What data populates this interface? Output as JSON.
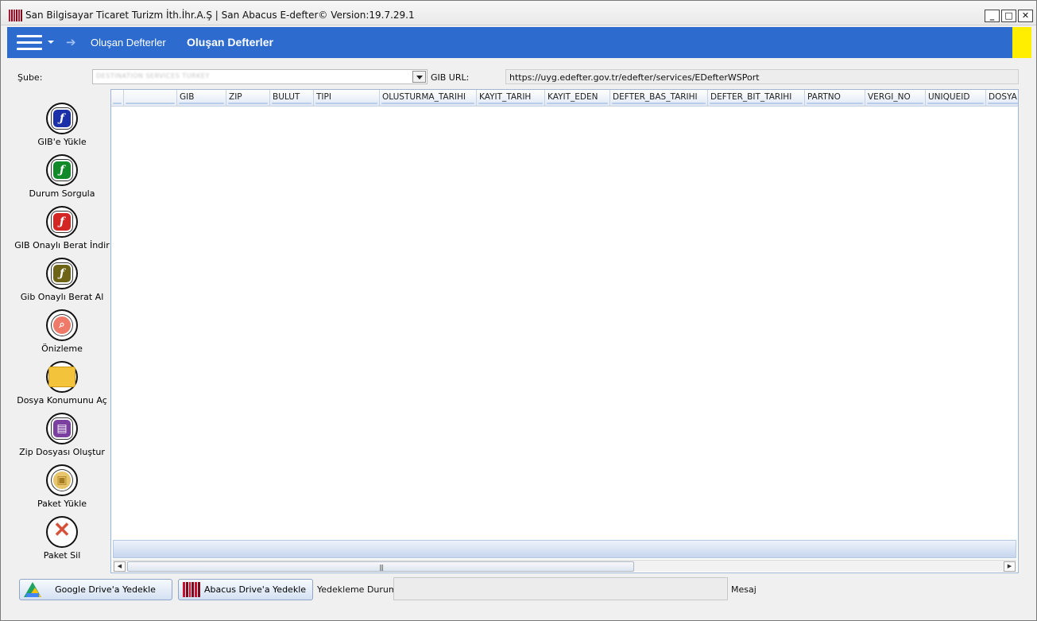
{
  "window": {
    "title": "San Bilgisayar Ticaret Turizm İth.İhr.A.Ş | San Abacus E-defter© Version:19.7.29.1",
    "buttons": {
      "minimize": "_",
      "maximize": "□",
      "close": "✕"
    }
  },
  "navbar": {
    "link": "Oluşan Defterler",
    "title": "Oluşan Defterler",
    "accent_color": "#2d6bcf",
    "marker_color": "#ffee00"
  },
  "filters": {
    "sube_label": "Şube:",
    "sube_value": "DESTINATION SERVICES TURKEY",
    "gib_url_label": "GIB URL:",
    "gib_url_value": "https://uyg.edefter.gov.tr/edefter/services/EDefterWSPort"
  },
  "sidebar": {
    "items": [
      {
        "label": "GIB'e Yükle",
        "icon": "upload-doc-icon",
        "color": "#1a2fa8"
      },
      {
        "label": "Durum Sorgula",
        "icon": "status-doc-icon",
        "color": "#128a2a"
      },
      {
        "label": "GIB Onaylı Berat İndir",
        "icon": "download-doc-icon",
        "color": "#d42525"
      },
      {
        "label": "Gib Onaylı Berat Al",
        "icon": "receipt-doc-icon",
        "color": "#6e6416"
      },
      {
        "label": "Önizleme",
        "icon": "preview-icon",
        "color": "#f07a6a"
      },
      {
        "label": "Dosya Konumunu Aç",
        "icon": "folder-icon",
        "color": "#f2c33b"
      },
      {
        "label": "Zip Dosyası Oluştur",
        "icon": "zip-archive-icon",
        "color": "#7b3fa0"
      },
      {
        "label": "Paket Yükle",
        "icon": "package-icon",
        "color": "#e8c56a"
      },
      {
        "label": "Paket Sil",
        "icon": "delete-x-icon",
        "color": "#d4523a"
      }
    ]
  },
  "grid": {
    "columns": [
      "",
      "",
      "GIB",
      "ZIP",
      "BULUT",
      "TIPI",
      "OLUSTURMA_TARIHI",
      "KAYIT_TARIH",
      "KAYIT_EDEN",
      "DEFTER_BAS_TARIHI",
      "DEFTER_BIT_TARIHI",
      "PARTNO",
      "VERGI_NO",
      "UNIQUEID",
      "DOSYA"
    ],
    "rows": []
  },
  "bottom": {
    "google_backup": "Google Drive'a Yedekle",
    "abacus_backup": "Abacus Drive'a Yedekle",
    "backup_status_label": "Yedekleme Durumu",
    "message_label": "Mesaj"
  }
}
